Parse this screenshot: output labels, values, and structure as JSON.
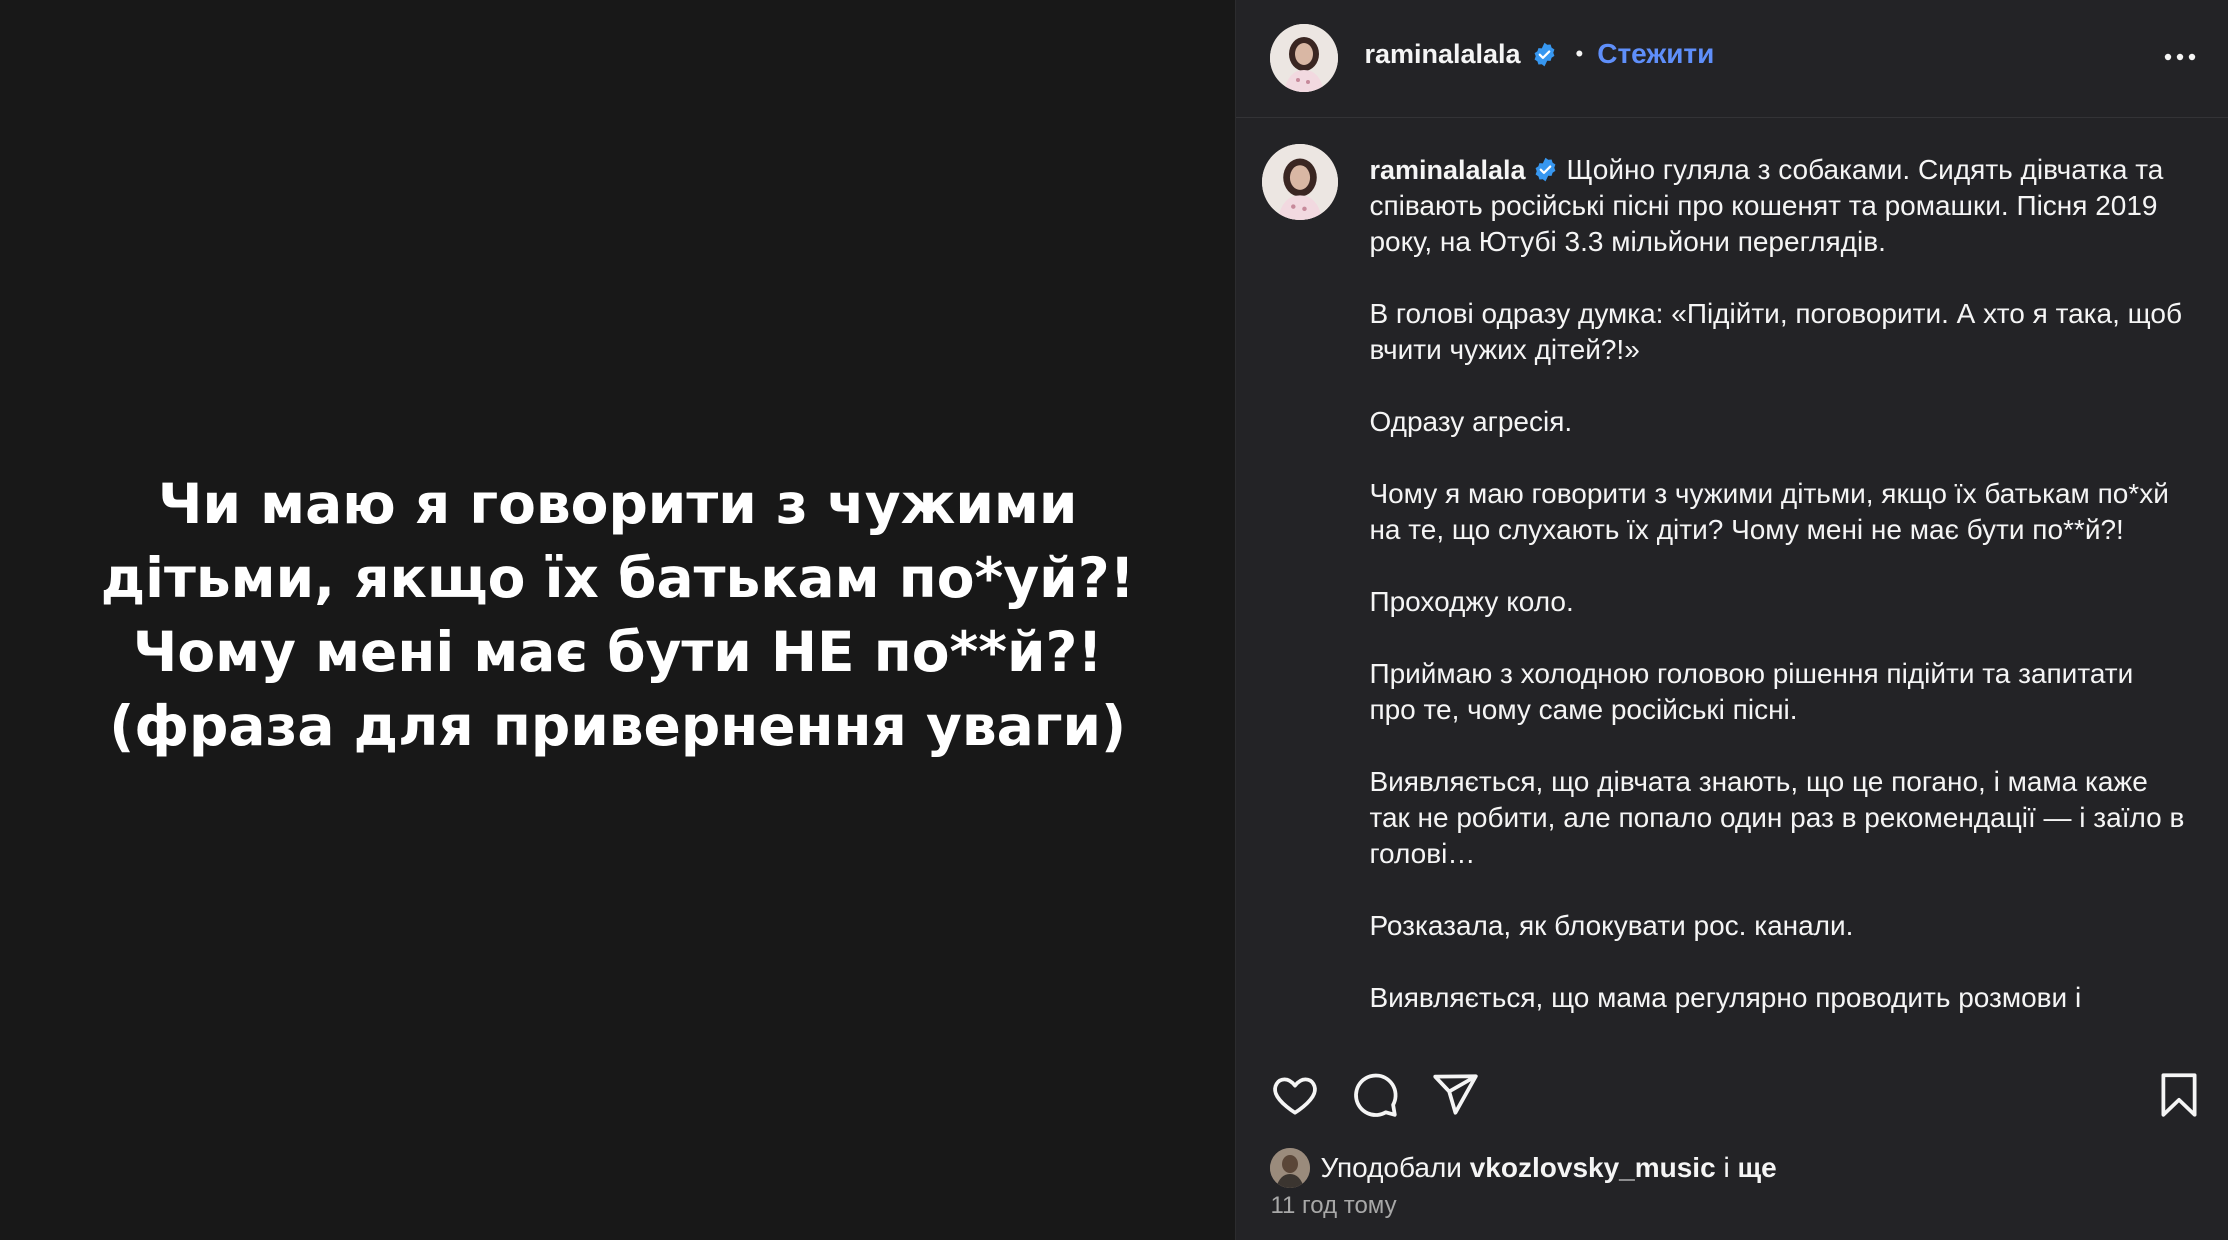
{
  "media": {
    "lines": [
      "Чи маю я говорити з чужими",
      "дітьми, якщо їх батькам по*уй?!",
      "Чому мені має бути НЕ по**й?!",
      "(фраза для привернення уваги)"
    ]
  },
  "header": {
    "username": "raminalalala",
    "separator": "•",
    "follow_label": "Стежити",
    "more_icon": "more-horizontal-icon"
  },
  "caption": {
    "username": "raminalalala",
    "first_paragraph": "Щойно гуляла з собаками. Сидять дівчатка та співають російські пісні про кошенят та ромашки. Пісня 2019 року, на Ютубі 3.3 мільйони переглядів.",
    "paragraphs": [
      "В голові одразу думка: «Підійти, поговорити. А хто я така, щоб вчити чужих дітей?!»",
      "Одразу агресія.",
      "Чому я маю говорити з чужими дітьми, якщо їх батькам по*хй на те, що слухають їх діти? Чому мені не має бути по**й?!",
      "Проходжу коло.",
      "Приймаю з холодною головою рішення підійти та запитати про те, чому саме російські пісні.",
      "Виявляється, що дівчата знають, що це погано, і мама каже так не робити, але попало один раз в рекомендації — і заїло в голові…",
      "Розказала, як блокувати рос. канали.",
      "Виявляється, що мама регулярно проводить розмови і"
    ]
  },
  "actions": {
    "like_icon": "heart-icon",
    "comment_icon": "comment-icon",
    "share_icon": "send-icon",
    "save_icon": "bookmark-icon"
  },
  "likes": {
    "prefix": "Уподобали",
    "user": "vkozlovsky_music",
    "conj": "і",
    "more": "ще"
  },
  "timestamp": "11 год тому",
  "colors": {
    "accent": "#5f8ffa",
    "verified": "#3797f0",
    "panel_bg": "#232326",
    "media_bg": "#181818"
  }
}
